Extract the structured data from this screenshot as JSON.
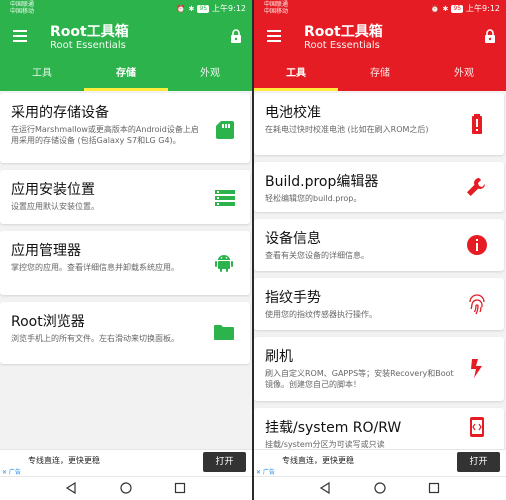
{
  "left": {
    "header_color": "#2db34b",
    "status": {
      "carrier1": "中国联通",
      "carrier2": "中国移动",
      "battery": "95",
      "time": "上午9:12"
    },
    "app": {
      "title": "Root工具箱",
      "subtitle": "Root Essentials"
    },
    "tabs": [
      {
        "label": "工具",
        "active": false
      },
      {
        "label": "存储",
        "active": true
      },
      {
        "label": "外观",
        "active": false
      }
    ],
    "cards": [
      {
        "title": "采用的存储设备",
        "desc": "在运行Marshmallow或更高版本的Android设备上启用采用的存储设备 (包括Galaxy S7和LG G4)。",
        "icon": "sd-card-icon"
      },
      {
        "title": "应用安装位置",
        "desc": "设置应用默认安装位置。",
        "icon": "storage-list-icon"
      },
      {
        "title": "应用管理器",
        "desc": "掌控您的应用。查看详细信息并卸载系统应用。",
        "icon": "android-icon"
      },
      {
        "title": "Root浏览器",
        "desc": "浏览手机上的所有文件。左右滑动来切换面板。",
        "icon": "folder-icon"
      }
    ],
    "ad": {
      "text": "专线直连，更快更稳",
      "tag": "✕ 广告",
      "button": "打开"
    }
  },
  "right": {
    "header_color": "#e51c23",
    "status": {
      "carrier1": "中国联通",
      "carrier2": "中国移动",
      "battery": "95",
      "time": "上午9:12"
    },
    "app": {
      "title": "Root工具箱",
      "subtitle": "Root Essentials"
    },
    "tabs": [
      {
        "label": "工具",
        "active": true
      },
      {
        "label": "存储",
        "active": false
      },
      {
        "label": "外观",
        "active": false
      }
    ],
    "cards": [
      {
        "title": "电池校准",
        "desc": "在耗电过快时校准电池 (比如在刷入ROM之后)",
        "icon": "battery-alert-icon"
      },
      {
        "title": "Build.prop编辑器",
        "desc": "轻松编辑您的build.prop。",
        "icon": "wrench-icon"
      },
      {
        "title": "设备信息",
        "desc": "查看有关您设备的详细信息。",
        "icon": "info-icon"
      },
      {
        "title": "指纹手势",
        "desc": "使用您的指纹传感器执行操作。",
        "icon": "fingerprint-icon"
      },
      {
        "title": "刷机",
        "desc": "刷入自定义ROM、GAPPS等；安装Recovery和Boot镜像。创建您自己的脚本！",
        "icon": "flash-icon"
      },
      {
        "title": "挂载/system RO/RW",
        "desc": "挂载/system分区为可读写或只读",
        "icon": "phone-code-icon"
      }
    ],
    "ad": {
      "text": "专线直连，更快更稳",
      "tag": "✕ 广告",
      "button": "打开"
    }
  }
}
